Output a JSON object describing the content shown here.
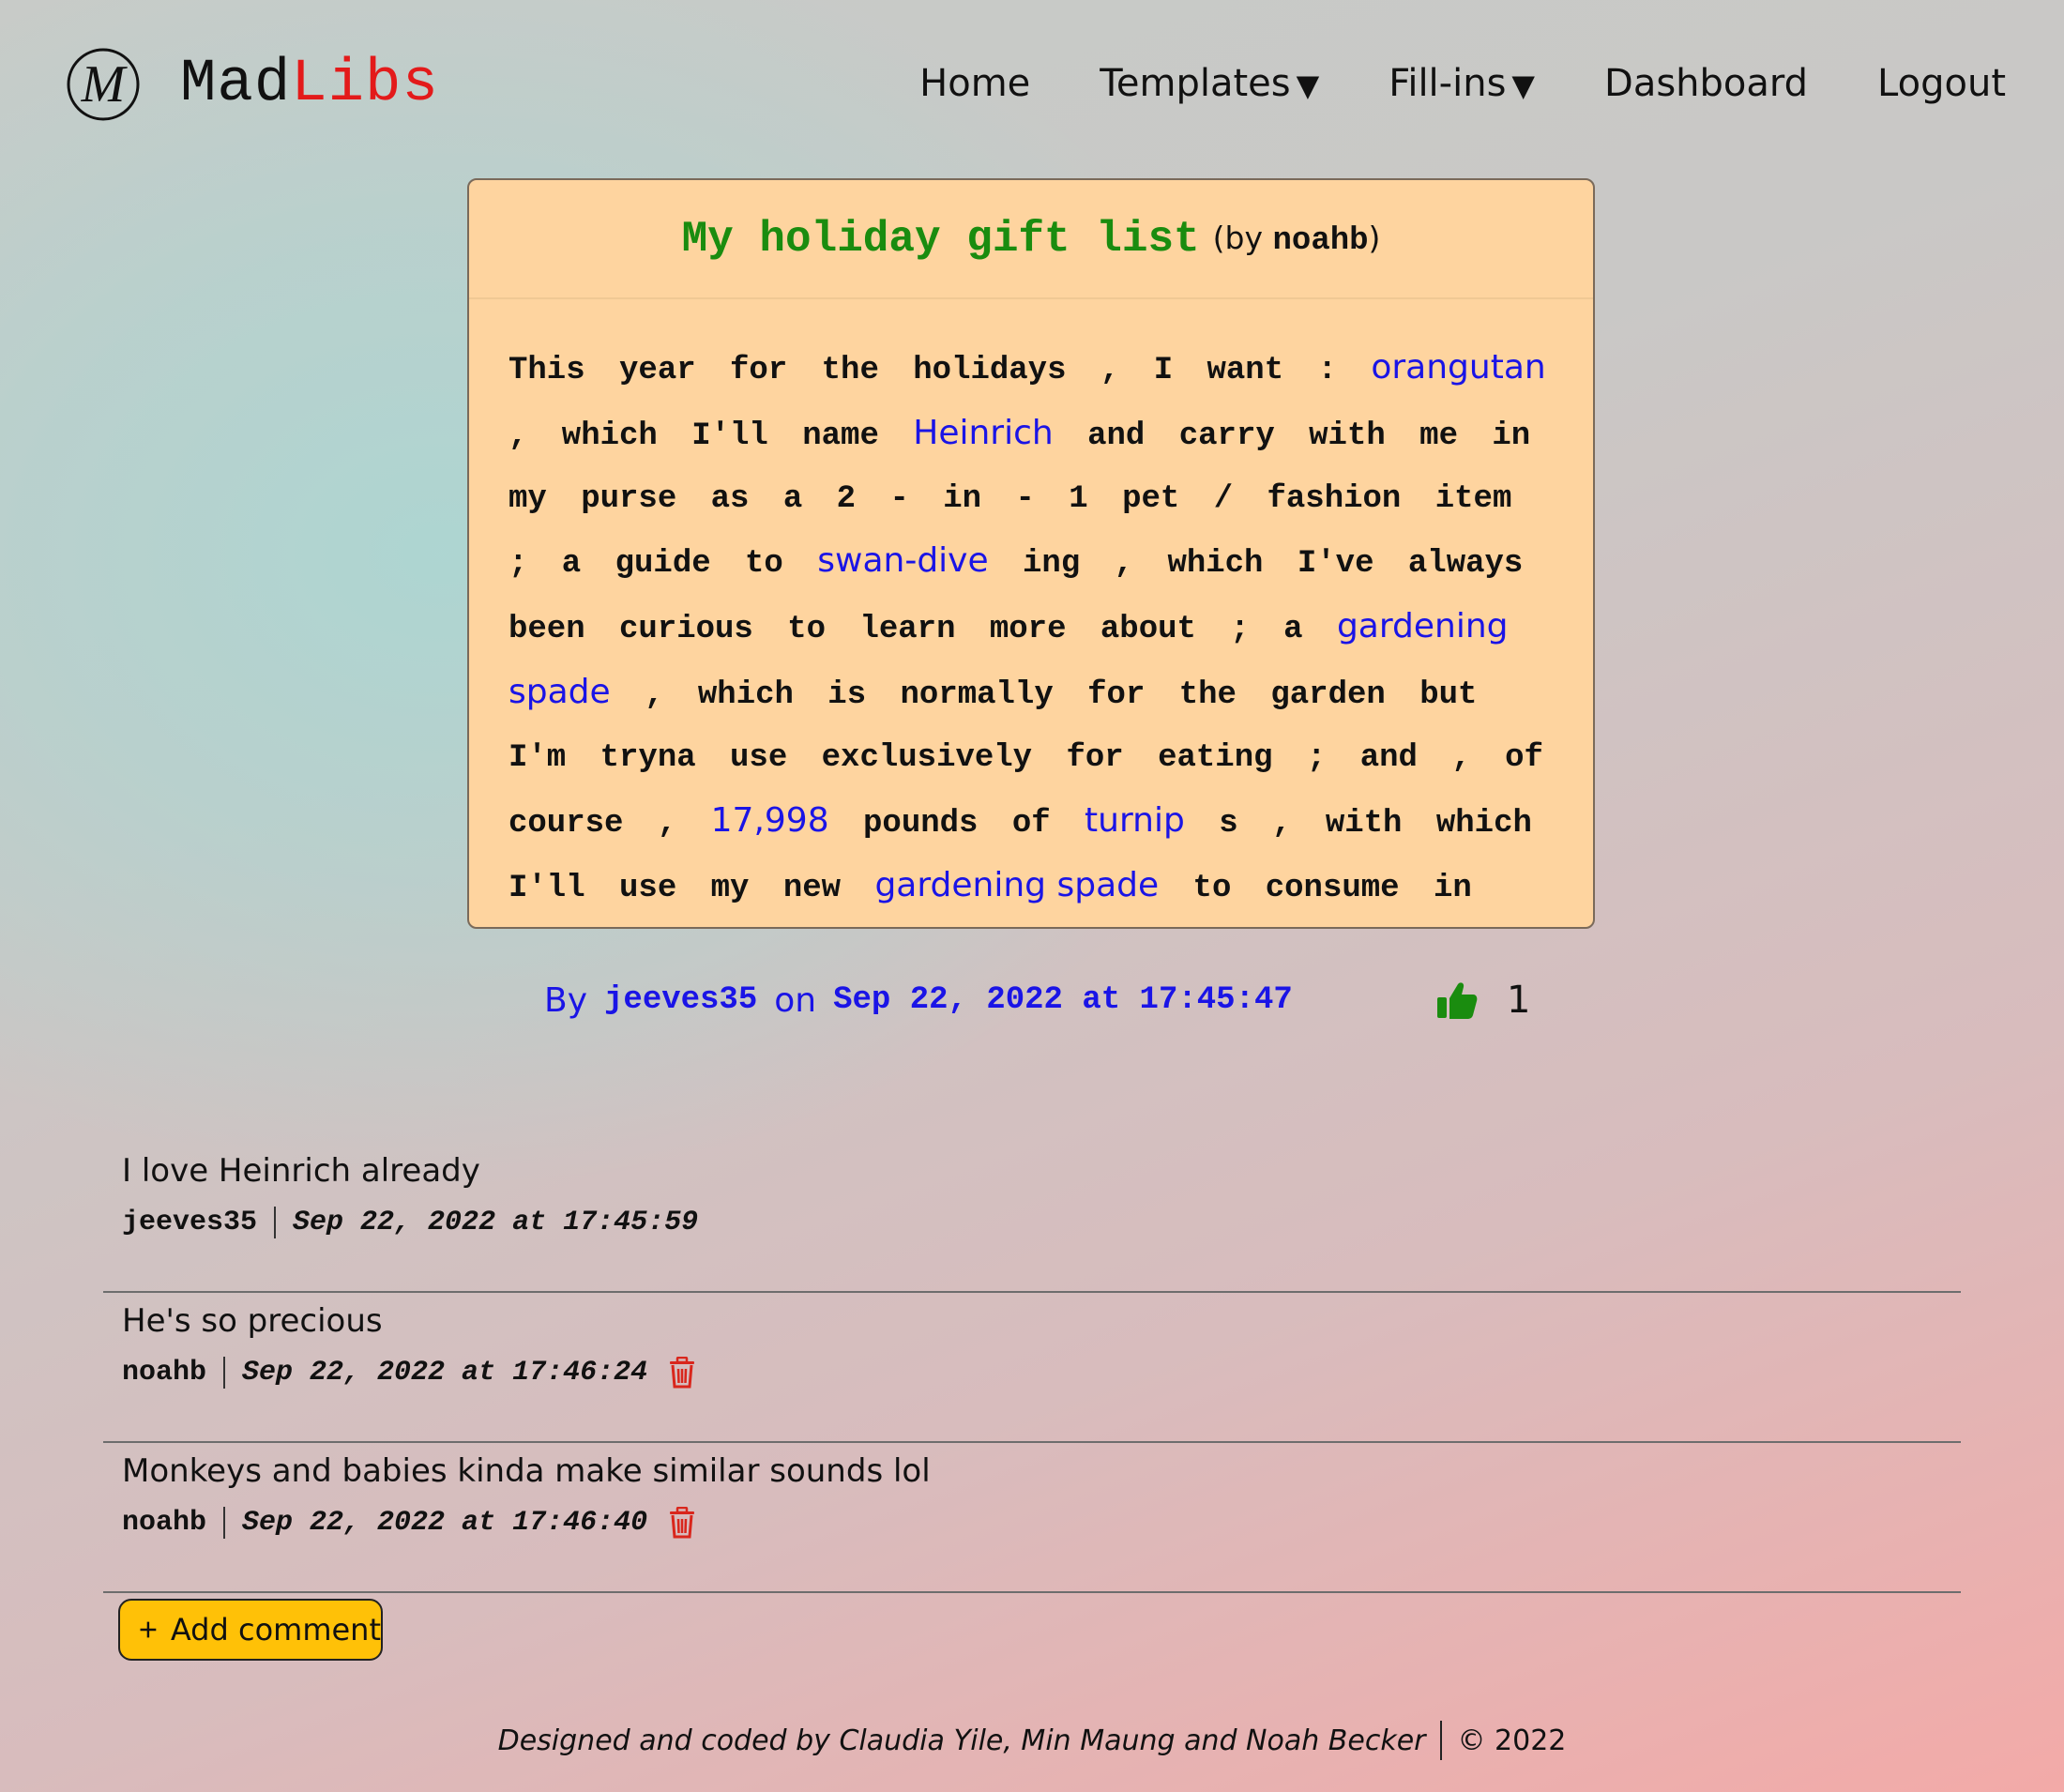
{
  "brand": {
    "name_part1": "Mad",
    "name_part2": "Libs",
    "logo_icon": "m-circle-logo-icon",
    "accent_color": "#e31a1a"
  },
  "nav": {
    "home": "Home",
    "templates": "Templates",
    "fillins": "Fill-ins",
    "dashboard": "Dashboard",
    "logout": "Logout",
    "caret": "▼"
  },
  "story": {
    "title": "My holiday gift list",
    "by_open": "(by",
    "template_author": "noahb",
    "by_close": ")",
    "segments": [
      {
        "text": "This year for the holidays , I want : ",
        "fill": false
      },
      {
        "text": "orangutan",
        "fill": true
      },
      {
        "text": " , which I'll name ",
        "fill": false
      },
      {
        "text": "Heinrich",
        "fill": true
      },
      {
        "text": " and carry with me in my purse as a 2 - in - 1 pet / fashion item ; a guide to ",
        "fill": false
      },
      {
        "text": "swan-dive",
        "fill": true
      },
      {
        "text": " ing , which I've always been curious to learn more about ; a ",
        "fill": false
      },
      {
        "text": "gardening spade",
        "fill": true
      },
      {
        "text": " , which is normally for the garden but I'm tryna use exclusively for eating ; and , of course , ",
        "fill": false
      },
      {
        "text": "17,998",
        "fill": true
      },
      {
        "text": " pounds of ",
        "fill": false
      },
      {
        "text": "turnip",
        "fill": true
      },
      {
        "text": " s , with which I'll use my new ",
        "fill": false
      },
      {
        "text": "gardening spade",
        "fill": true
      },
      {
        "text": " to consume in earnest .",
        "fill": false
      }
    ],
    "title_color": "#1a8c0f",
    "fill_color": "#1a14e6",
    "card_color": "#fed49f"
  },
  "meta": {
    "by_label": "By",
    "author": "jeeves35",
    "on_label": "on",
    "date": "Sep 22, 2022 at 17:45:47",
    "like_icon": "thumbs-up-icon",
    "like_count": "1"
  },
  "comments": [
    {
      "text": "I love Heinrich already",
      "user": "jeeves35",
      "time": "Sep 22, 2022 at 17:45:59",
      "deletable": false
    },
    {
      "text": "He's so precious",
      "user": "noahb",
      "time": "Sep 22, 2022 at 17:46:24",
      "deletable": true
    },
    {
      "text": "Monkeys and babies kinda make similar sounds lol",
      "user": "noahb",
      "time": "Sep 22, 2022 at 17:46:40",
      "deletable": true
    }
  ],
  "add_comment": {
    "label": "Add comment",
    "icon": "plus-icon",
    "color": "#ffc107"
  },
  "footer": {
    "credits": "Designed and coded by Claudia Yile, Min Maung and Noah Becker",
    "copyright": "© 2022"
  }
}
